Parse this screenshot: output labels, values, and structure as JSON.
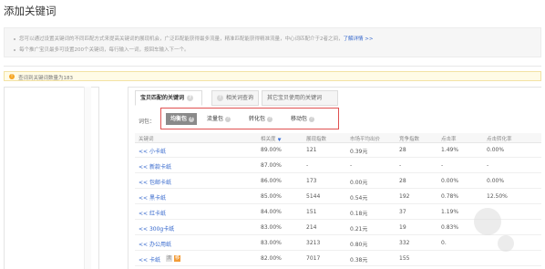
{
  "page_title": "添加关键词",
  "notice": {
    "line1": "您可以通过设置关键词的不同匹配方式来提高关键词的展现机会，广泛匹配能获得最多流量，精准匹配能获得精准流量，中心词匹配介于2者之间，",
    "line1_link": "了解详情 >>",
    "line2": "每个推广宝贝最多可设置200个关键词，每行输入一词，按回车输入下一个。"
  },
  "count_text": "查词到关键词数量为183",
  "tabs": [
    {
      "label": "宝贝匹配的关键词",
      "active": true
    },
    {
      "label": "相关词查询",
      "active": false
    },
    {
      "label": "其它宝贝使用的关键词",
      "active": false
    }
  ],
  "package_label": "词包：",
  "packages": [
    {
      "label": "均衡包",
      "active": true
    },
    {
      "label": "流量包",
      "active": false
    },
    {
      "label": "转化包",
      "active": false
    },
    {
      "label": "移动包",
      "active": false
    }
  ],
  "columns": [
    "关键词",
    "相关度",
    "展现指数",
    "市场平均出价",
    "竞争指数",
    "点击率",
    "点击转化率"
  ],
  "rows": [
    {
      "kw": "<< 小卡纸",
      "rel": "89.00%",
      "show": "121",
      "price": "0.39元",
      "comp": "28",
      "ctr": "1.49%",
      "cvr": "0.00%",
      "tags": []
    },
    {
      "kw": "<< 新款卡纸",
      "rel": "87.00%",
      "show": "-",
      "price": "-",
      "comp": "-",
      "ctr": "-",
      "cvr": "-",
      "tags": []
    },
    {
      "kw": "<< 包邮卡纸",
      "rel": "86.00%",
      "show": "173",
      "price": "0.00元",
      "comp": "28",
      "ctr": "0.00%",
      "cvr": "0.00%",
      "tags": []
    },
    {
      "kw": "<< 黑卡纸",
      "rel": "85.00%",
      "show": "5144",
      "price": "0.54元",
      "comp": "192",
      "ctr": "0.78%",
      "cvr": "12.50%",
      "tags": []
    },
    {
      "kw": "<< 红卡纸",
      "rel": "84.00%",
      "show": "151",
      "price": "0.18元",
      "comp": "37",
      "ctr": "1.19%",
      "cvr": "",
      "tags": []
    },
    {
      "kw": "<< 300g卡纸",
      "rel": "83.00%",
      "show": "214",
      "price": "0.21元",
      "comp": "19",
      "ctr": "0.83%",
      "cvr": "",
      "tags": []
    },
    {
      "kw": "<< 办公用纸",
      "rel": "83.00%",
      "show": "3213",
      "price": "0.80元",
      "comp": "332",
      "ctr": "0.",
      "cvr": "",
      "tags": []
    },
    {
      "kw": "<< 卡纸",
      "rel": "82.00%",
      "show": "7017",
      "price": "0.38元",
      "comp": "155",
      "ctr": "",
      "cvr": "",
      "tags": [
        "流",
        "移"
      ]
    }
  ]
}
